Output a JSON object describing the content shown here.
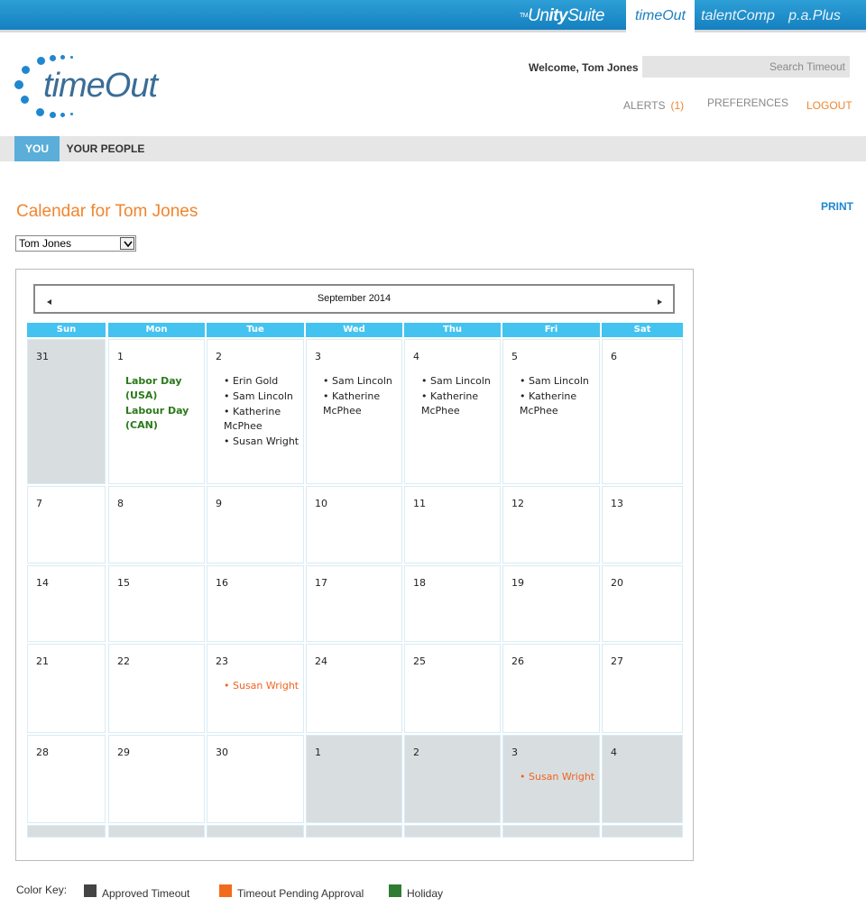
{
  "suite": {
    "brand_prefix": "Un",
    "brand_bold": "ity",
    "brand_suffix": "Suite",
    "apps": [
      "timeOut",
      "talentComp",
      "p.a.Plus"
    ],
    "active_app": "timeOut"
  },
  "header": {
    "logo_text": "timeOut",
    "welcome": "Welcome,  Tom Jones",
    "search_placeholder": "Search Timeout",
    "alerts_label": "ALERTS",
    "alerts_count": "(1)",
    "preferences_label": "PREFERENCES",
    "logout_label": "LOGOUT"
  },
  "nav": {
    "tabs": [
      "YOU",
      "YOUR PEOPLE"
    ],
    "active_tab": "YOU"
  },
  "page": {
    "title": "Calendar for Tom Jones",
    "print_label": "PRINT",
    "person_select_value": "Tom Jones"
  },
  "calendar": {
    "month_label": "September 2014",
    "weekdays": [
      "Sun",
      "Mon",
      "Tue",
      "Wed",
      "Thu",
      "Fri",
      "Sat"
    ],
    "weeks": [
      [
        {
          "day": "31",
          "other": true
        },
        {
          "day": "1",
          "events": [
            "Labor Day (USA)",
            "Labour Day (CAN)"
          ],
          "kind": "holiday"
        },
        {
          "day": "2",
          "events": [
            "Erin Gold",
            "Sam Lincoln",
            "Katherine McPhee",
            "Susan Wright"
          ],
          "kind": "approved"
        },
        {
          "day": "3",
          "events": [
            "Sam Lincoln",
            "Katherine McPhee"
          ],
          "kind": "approved"
        },
        {
          "day": "4",
          "events": [
            "Sam Lincoln",
            "Katherine McPhee"
          ],
          "kind": "approved"
        },
        {
          "day": "5",
          "events": [
            "Sam Lincoln",
            "Katherine McPhee"
          ],
          "kind": "approved"
        },
        {
          "day": "6"
        }
      ],
      [
        {
          "day": "7"
        },
        {
          "day": "8"
        },
        {
          "day": "9"
        },
        {
          "day": "10"
        },
        {
          "day": "11"
        },
        {
          "day": "12"
        },
        {
          "day": "13"
        }
      ],
      [
        {
          "day": "14"
        },
        {
          "day": "15"
        },
        {
          "day": "16"
        },
        {
          "day": "17"
        },
        {
          "day": "18"
        },
        {
          "day": "19"
        },
        {
          "day": "20"
        }
      ],
      [
        {
          "day": "21"
        },
        {
          "day": "22"
        },
        {
          "day": "23",
          "events": [
            "Susan Wright"
          ],
          "kind": "pending"
        },
        {
          "day": "24"
        },
        {
          "day": "25"
        },
        {
          "day": "26"
        },
        {
          "day": "27"
        }
      ],
      [
        {
          "day": "28"
        },
        {
          "day": "29"
        },
        {
          "day": "30"
        },
        {
          "day": "1",
          "other": true
        },
        {
          "day": "2",
          "other": true
        },
        {
          "day": "3",
          "other": true,
          "events": [
            "Susan Wright"
          ],
          "kind": "pending"
        },
        {
          "day": "4",
          "other": true
        }
      ]
    ]
  },
  "color_key": {
    "label": "Color Key:",
    "items": [
      {
        "label": "Approved Timeout",
        "color": "#444444"
      },
      {
        "label": "Timeout Pending Approval",
        "color": "#f26b1d"
      },
      {
        "label": "Holiday",
        "color": "#2f7d32"
      }
    ]
  },
  "colors": {
    "accent_orange": "#f0852e",
    "accent_blue": "#1f87cf",
    "weekday_header": "#44c3f0",
    "holiday_text": "#2a7a1a",
    "pending_text": "#f0641e"
  }
}
